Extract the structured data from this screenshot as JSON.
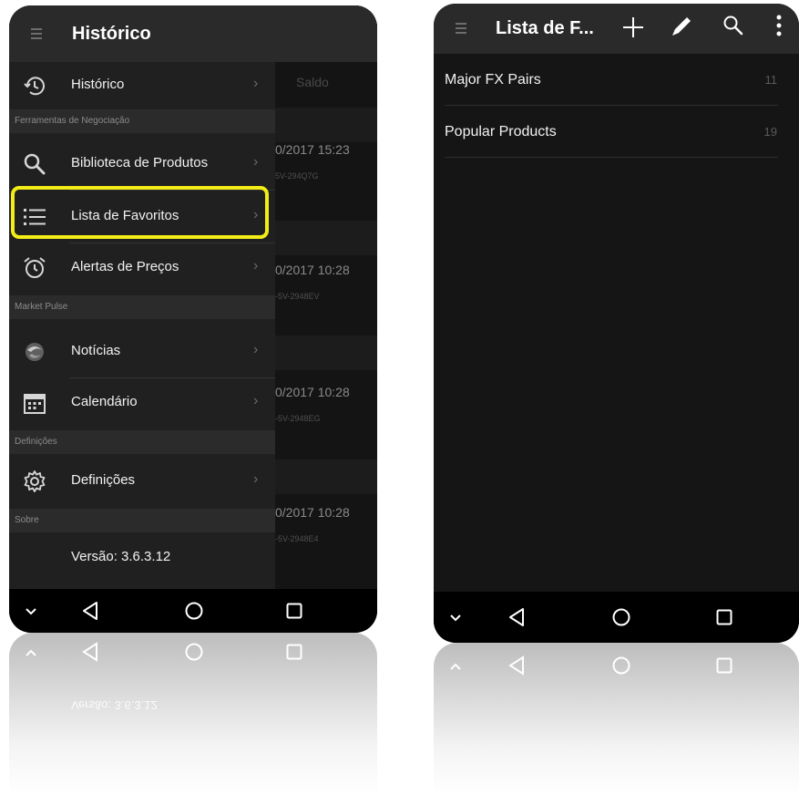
{
  "left_phone": {
    "header_title": "Histórico",
    "background": {
      "column_header": "Saldo",
      "rows": [
        {
          "date": "0/2017 15:23",
          "id": "5V-294Q7G"
        },
        {
          "date": "0/2017 10:28",
          "id": "-5V-2948EV"
        },
        {
          "date": "0/2017 10:28",
          "id": "-5V-2948EG"
        },
        {
          "date": "0/2017 10:28",
          "id": "-5V-2948E4"
        }
      ]
    },
    "menu": {
      "historico": "Histórico",
      "section_tools": "Ferramentas de Negociação",
      "biblioteca": "Biblioteca de Produtos",
      "favoritos": "Lista de Favoritos",
      "alertas": "Alertas de Preços",
      "section_pulse": "Market Pulse",
      "noticias": "Notícias",
      "calendario": "Calendário",
      "section_settings": "Definições",
      "definicoes": "Definições",
      "section_about": "Sobre",
      "version": "Versão: 3.6.3.12",
      "chevron": "›"
    },
    "highlight_color": "#f2ec17"
  },
  "right_phone": {
    "header_title": "Lista de F...",
    "lists": [
      {
        "name": "Major FX Pairs",
        "count": "11"
      },
      {
        "name": "Popular Products",
        "count": "19"
      }
    ]
  },
  "reflection": {
    "mirrored_version": "Versão: 3.6.3.12"
  },
  "icons": {
    "hamburger": "hamburger-icon",
    "history": "history-icon",
    "search": "search-icon",
    "list": "list-icon",
    "alarm": "alarm-clock-icon",
    "news": "news-icon",
    "calendar": "calendar-icon",
    "settings": "gear-icon",
    "add": "plus-icon",
    "edit": "pencil-icon",
    "more": "more-vertical-icon",
    "nav_down": "chevron-down-icon",
    "nav_back": "back-triangle-icon",
    "nav_home": "home-circle-icon",
    "nav_recent": "recents-square-icon"
  }
}
